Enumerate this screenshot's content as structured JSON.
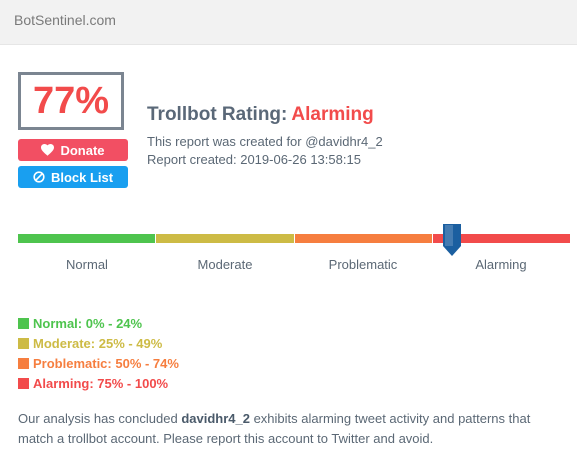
{
  "site": {
    "name": "BotSentinel.com"
  },
  "score": {
    "percent": "77%"
  },
  "buttons": {
    "donate": "Donate",
    "block_list": "Block List"
  },
  "report": {
    "title_prefix": "Trollbot Rating:",
    "rating": "Alarming",
    "created_for": "This report was created for @davidhr4_2",
    "created_at": "Report created: 2019-06-26 13:58:15"
  },
  "scale": {
    "segments": [
      {
        "label": "Normal",
        "color": "#4ec44e"
      },
      {
        "label": "Moderate",
        "color": "#cdbb45"
      },
      {
        "label": "Problematic",
        "color": "#f67e3f"
      },
      {
        "label": "Alarming",
        "color": "#f24b4b"
      }
    ],
    "marker_value": 77,
    "marker_color": "#1b5fa0"
  },
  "legend": [
    {
      "text": "Normal: 0% - 24%",
      "color": "#4ec44e"
    },
    {
      "text": "Moderate: 25% - 49%",
      "color": "#cdbb45"
    },
    {
      "text": "Problematic: 50% - 74%",
      "color": "#f67e3f"
    },
    {
      "text": "Alarming: 75% - 100%",
      "color": "#f24b4b"
    }
  ],
  "summary": {
    "before": "Our analysis has concluded ",
    "username": "davidhr4_2",
    "after": " exhibits alarming tweet activity and patterns that match a trollbot account. Please report this account to Twitter and avoid."
  }
}
